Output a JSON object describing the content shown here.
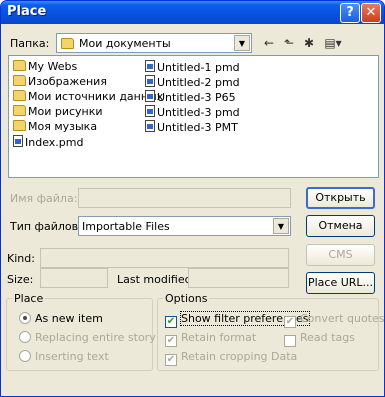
{
  "window": {
    "title": "Place",
    "help_label": "?",
    "close_label": "✕"
  },
  "lookin": {
    "label": "Папка:",
    "value": "Мои документы"
  },
  "toolbar": {
    "back_icon": "←",
    "up_icon": "⬑",
    "newfolder_icon": "✱",
    "views_icon": "▤▾"
  },
  "files_col1": [
    "My Webs",
    "Изображения",
    "Мои источники данных",
    "Мои рисунки",
    "Моя музыка",
    "Index.pmd"
  ],
  "files_col2": [
    "Untitled-1 pmd",
    "Untitled-2 pmd",
    "Untitled-3 P65",
    "Untitled-3 pmd",
    "Untitled-3 PMT"
  ],
  "filename": {
    "label": "Имя файла:",
    "value": ""
  },
  "filetype": {
    "label": "Тип файлов:",
    "value": "Importable Files"
  },
  "buttons": {
    "open": "Открыть",
    "cancel": "Отмена",
    "cms": "CMS source...",
    "place_url": "Place URL..."
  },
  "info": {
    "kind_label": "Kind:",
    "size_label": "Size:",
    "modified_label": "Last modified:"
  },
  "place": {
    "title": "Place",
    "options": [
      "As new item",
      "Replacing entire story",
      "Inserting text"
    ],
    "selected": 0
  },
  "options": {
    "title": "Options",
    "show_filter": "Show filter preferences",
    "convert_quotes": "Convert quotes",
    "retain_format": "Retain format",
    "read_tags": "Read tags",
    "retain_cropping": "Retain cropping Data"
  }
}
